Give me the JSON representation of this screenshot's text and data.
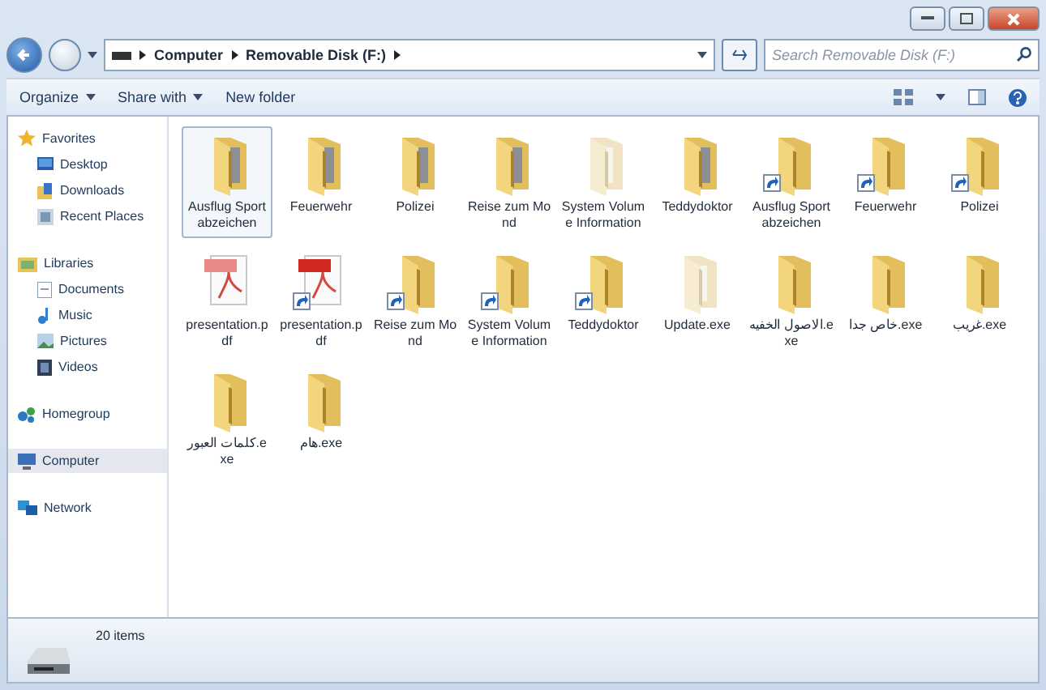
{
  "address": {
    "crumbs": [
      "Computer",
      "Removable Disk (F:)"
    ]
  },
  "search": {
    "placeholder": "Search Removable Disk (F:)"
  },
  "toolbar": {
    "buttons": [
      {
        "label": "Organize",
        "dropdown": true
      },
      {
        "label": "Share with",
        "dropdown": true
      },
      {
        "label": "New folder",
        "dropdown": false
      }
    ]
  },
  "sidebar": {
    "groups": [
      {
        "label": "Favorites",
        "items": [
          {
            "label": "Desktop",
            "selected": false
          },
          {
            "label": "Downloads",
            "selected": false
          },
          {
            "label": "Recent Places",
            "selected": false
          }
        ]
      },
      {
        "label": "Libraries",
        "items": [
          {
            "label": "Documents",
            "selected": false
          },
          {
            "label": "Music",
            "selected": false
          },
          {
            "label": "Pictures",
            "selected": false
          },
          {
            "label": "Videos",
            "selected": false
          }
        ]
      },
      {
        "label": "Homegroup",
        "selected": false
      },
      {
        "label": "Computer",
        "selected": true
      },
      {
        "label": "Network",
        "selected": false
      }
    ]
  },
  "files": [
    {
      "name": "Ausflug Sportabzeichen",
      "kind": "photo-folder",
      "shortcut": false,
      "selected": true
    },
    {
      "name": "Feuerwehr",
      "kind": "photo-folder",
      "shortcut": false,
      "selected": false
    },
    {
      "name": "Polizei",
      "kind": "photo-folder",
      "shortcut": false,
      "selected": false
    },
    {
      "name": "Reise zum Mond",
      "kind": "photo-folder",
      "shortcut": false,
      "selected": false
    },
    {
      "name": "System Volume Information",
      "kind": "pale-folder",
      "shortcut": false,
      "selected": false
    },
    {
      "name": "Teddydoktor",
      "kind": "photo-folder",
      "shortcut": false,
      "selected": false
    },
    {
      "name": "Ausflug Sportabzeichen",
      "kind": "folder",
      "shortcut": true,
      "selected": false
    },
    {
      "name": "Feuerwehr",
      "kind": "folder",
      "shortcut": true,
      "selected": false
    },
    {
      "name": "Polizei",
      "kind": "folder",
      "shortcut": true,
      "selected": false
    },
    {
      "name": "presentation.pdf",
      "kind": "pdf",
      "shortcut": false,
      "selected": false
    },
    {
      "name": "presentation.pdf",
      "kind": "pdf",
      "shortcut": true,
      "selected": false
    },
    {
      "name": "Reise zum Mond",
      "kind": "folder",
      "shortcut": true,
      "selected": false
    },
    {
      "name": "System Volume Information",
      "kind": "folder",
      "shortcut": true,
      "selected": false
    },
    {
      "name": "Teddydoktor",
      "kind": "folder",
      "shortcut": true,
      "selected": false
    },
    {
      "name": "Update.exe",
      "kind": "pale-folder",
      "shortcut": false,
      "selected": false
    },
    {
      "name": "الاصول الخفيه.exe",
      "kind": "folder",
      "shortcut": false,
      "selected": false
    },
    {
      "name": "خاص جدا.exe",
      "kind": "folder",
      "shortcut": false,
      "selected": false
    },
    {
      "name": "غريب.exe",
      "kind": "folder",
      "shortcut": false,
      "selected": false
    },
    {
      "name": "كلمات العبور.exe",
      "kind": "folder",
      "shortcut": false,
      "selected": false
    },
    {
      "name": "هام.exe",
      "kind": "folder",
      "shortcut": false,
      "selected": false
    }
  ],
  "status": {
    "text": "20 items"
  }
}
